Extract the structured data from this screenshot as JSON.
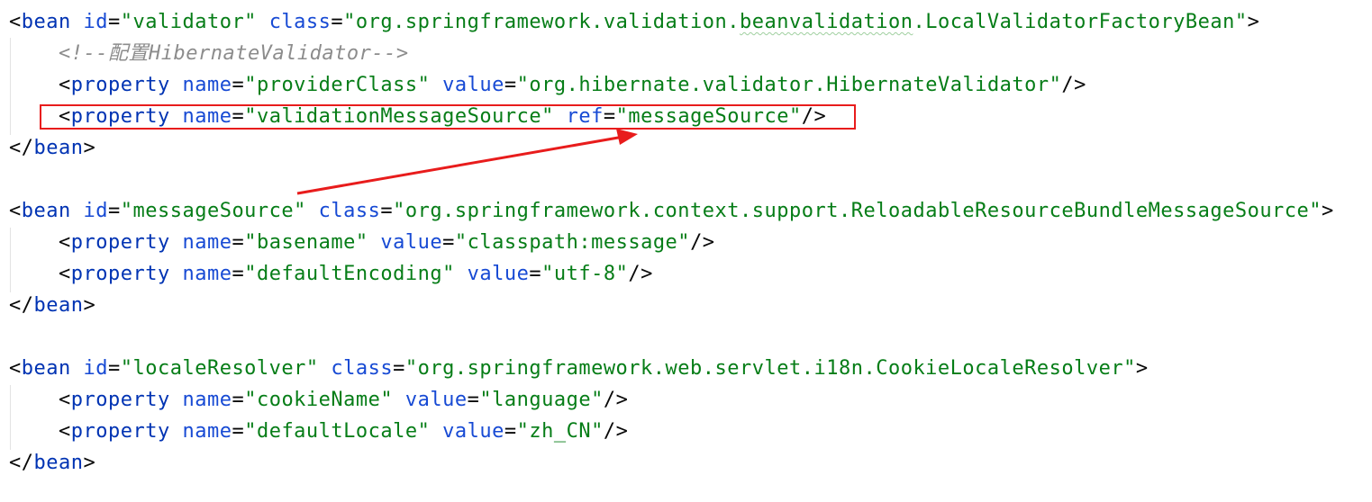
{
  "colors": {
    "tag": "#0033b3",
    "attribute": "#174ad4",
    "value": "#067d17",
    "comment": "#8c8c8c",
    "annotation": "#e81c1c"
  },
  "code": {
    "bean1_open": {
      "lt": "<",
      "tag": "bean",
      "attr1": "id",
      "eq1": "=",
      "val1": "\"validator\"",
      "attr2": "class",
      "eq2": "=",
      "val2_pre": "\"org.springframework.validation.",
      "val2_squiggle": "beanvalidation",
      "val2_post": ".LocalValidatorFactoryBean\"",
      "gt": ">"
    },
    "comment": "<!--配置HibernateValidator-->",
    "bean1_prop1": {
      "lt": "<",
      "tag": "property",
      "attr1": "name",
      "eq1": "=",
      "val1": "\"providerClass\"",
      "attr2": "value",
      "eq2": "=",
      "val2": "\"org.hibernate.validator.HibernateValidator\"",
      "end": "/>"
    },
    "bean1_prop2": {
      "lt": "<",
      "tag": "property",
      "attr1": "name",
      "eq1": "=",
      "val1": "\"validationMessageSource\"",
      "attr2": "ref",
      "eq2": "=",
      "val2": "\"messageSource\"",
      "end": "/>"
    },
    "bean1_close": {
      "lt": "</",
      "tag": "bean",
      "gt": ">"
    },
    "bean2_open": {
      "lt": "<",
      "tag": "bean",
      "attr1": "id",
      "eq1": "=",
      "val1": "\"messageSource\"",
      "attr2": "class",
      "eq2": "=",
      "val2": "\"org.springframework.context.support.ReloadableResourceBundleMessageSource\"",
      "gt": ">"
    },
    "bean2_prop1": {
      "lt": "<",
      "tag": "property",
      "attr1": "name",
      "eq1": "=",
      "val1": "\"basename\"",
      "attr2": "value",
      "eq2": "=",
      "val2": "\"classpath:message\"",
      "end": "/>"
    },
    "bean2_prop2": {
      "lt": "<",
      "tag": "property",
      "attr1": "name",
      "eq1": "=",
      "val1": "\"defaultEncoding\"",
      "attr2": "value",
      "eq2": "=",
      "val2": "\"utf-8\"",
      "end": "/>"
    },
    "bean2_close": {
      "lt": "</",
      "tag": "bean",
      "gt": ">"
    },
    "bean3_open": {
      "lt": "<",
      "tag": "bean",
      "attr1": "id",
      "eq1": "=",
      "val1": "\"localeResolver\"",
      "attr2": "class",
      "eq2": "=",
      "val2": "\"org.springframework.web.servlet.i18n.CookieLocaleResolver\"",
      "gt": ">"
    },
    "bean3_prop1": {
      "lt": "<",
      "tag": "property",
      "attr1": "name",
      "eq1": "=",
      "val1": "\"cookieName\"",
      "attr2": "value",
      "eq2": "=",
      "val2": "\"language\"",
      "end": "/>"
    },
    "bean3_prop2": {
      "lt": "<",
      "tag": "property",
      "attr1": "name",
      "eq1": "=",
      "val1": "\"defaultLocale\"",
      "attr2": "value",
      "eq2": "=",
      "val2": "\"zh_CN\"",
      "end": "/>"
    },
    "bean3_close": {
      "lt": "</",
      "tag": "bean",
      "gt": ">"
    }
  }
}
